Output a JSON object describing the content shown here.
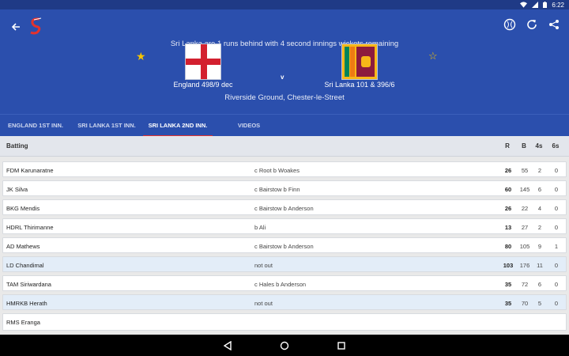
{
  "status": {
    "time": "6:22"
  },
  "header": {
    "summary": "Sri Lanka are 1 runs behind with 4 second innings wickets remaining",
    "home_team": "England 498/9 dec",
    "away_team": "Sri Lanka 101 & 396/6",
    "vs": "v",
    "venue": "Riverside Ground, Chester-le-Street"
  },
  "tabs": [
    {
      "label": "ENGLAND 1ST INN."
    },
    {
      "label": "SRI LANKA 1ST INN."
    },
    {
      "label": "SRI LANKA 2ND INN."
    },
    {
      "label": "VIDEOS"
    }
  ],
  "table": {
    "title": "Batting",
    "columns": [
      "R",
      "B",
      "4s",
      "6s"
    ],
    "rows": [
      {
        "name": "FDM Karunaratne",
        "dismissal": "c Root b Woakes",
        "r": "26",
        "b": "55",
        "fours": "2",
        "sixes": "0"
      },
      {
        "name": "JK Silva",
        "dismissal": "c Bairstow b Finn",
        "r": "60",
        "b": "145",
        "fours": "6",
        "sixes": "0"
      },
      {
        "name": "BKG Mendis",
        "dismissal": "c Bairstow b Anderson",
        "r": "26",
        "b": "22",
        "fours": "4",
        "sixes": "0"
      },
      {
        "name": "HDRL Thirimanne",
        "dismissal": "b Ali",
        "r": "13",
        "b": "27",
        "fours": "2",
        "sixes": "0"
      },
      {
        "name": "AD Mathews",
        "dismissal": "c Bairstow b Anderson",
        "r": "80",
        "b": "105",
        "fours": "9",
        "sixes": "1"
      },
      {
        "name": "LD Chandimal",
        "dismissal": "not out",
        "r": "103",
        "b": "176",
        "fours": "11",
        "sixes": "0"
      },
      {
        "name": "TAM Siriwardana",
        "dismissal": "c Hales b Anderson",
        "r": "35",
        "b": "72",
        "fours": "6",
        "sixes": "0"
      },
      {
        "name": "HMRKB Herath",
        "dismissal": "not out",
        "r": "35",
        "b": "70",
        "fours": "5",
        "sixes": "0"
      },
      {
        "name": "RMS Eranga",
        "dismissal": "",
        "r": "",
        "b": "",
        "fours": "",
        "sixes": ""
      }
    ]
  },
  "colors": {
    "header_bg": "#2b4fad",
    "accent": "#e5322d",
    "highlight_row": "#e3edf8",
    "star": "#f5c400"
  }
}
